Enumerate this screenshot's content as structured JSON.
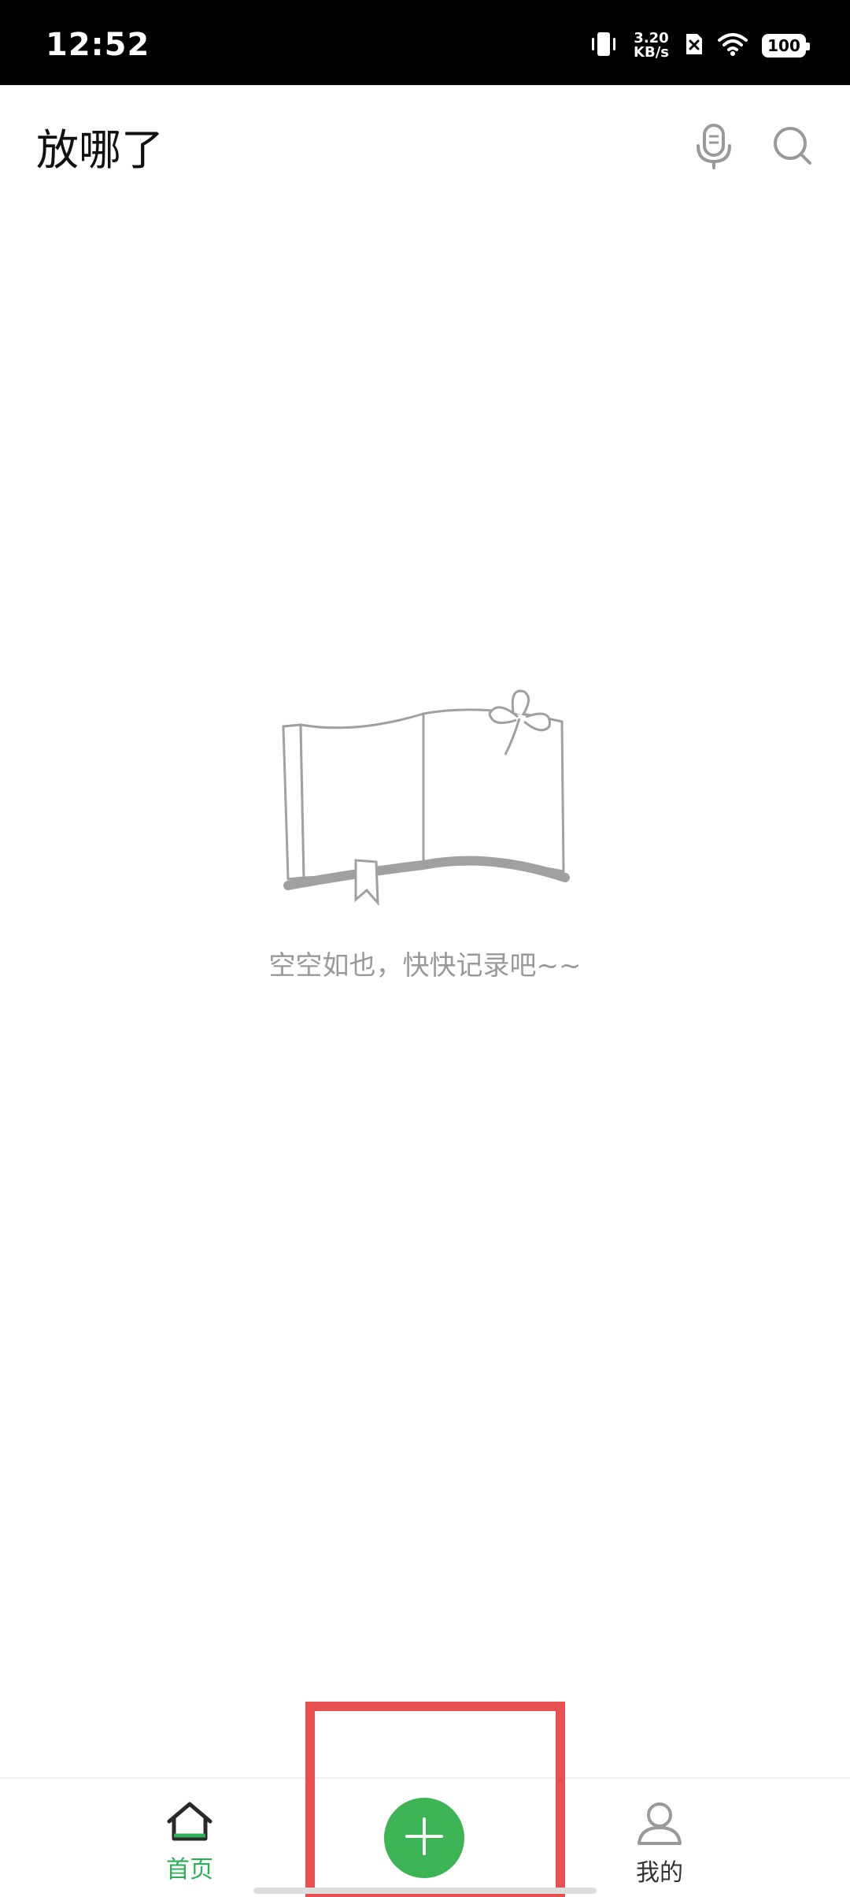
{
  "status_bar": {
    "time": "12:52",
    "net_speed_value": "3.20",
    "net_speed_unit": "KB/s",
    "battery": "100"
  },
  "header": {
    "title": "放哪了",
    "icons": [
      "mic-icon",
      "search-icon"
    ]
  },
  "empty_state": {
    "illustration": "open-book-icon",
    "message": "空空如也，快快记录吧~~"
  },
  "bottom_nav": {
    "items": [
      {
        "label": "首页",
        "icon": "home-icon",
        "active": true
      },
      {
        "label": "我的",
        "icon": "user-icon",
        "active": false
      }
    ],
    "add_icon": "plus-icon"
  },
  "colors": {
    "accent": "#3cb454",
    "active_label": "#2fae5a",
    "highlight": "#e8514f",
    "empty_text": "#999999"
  }
}
